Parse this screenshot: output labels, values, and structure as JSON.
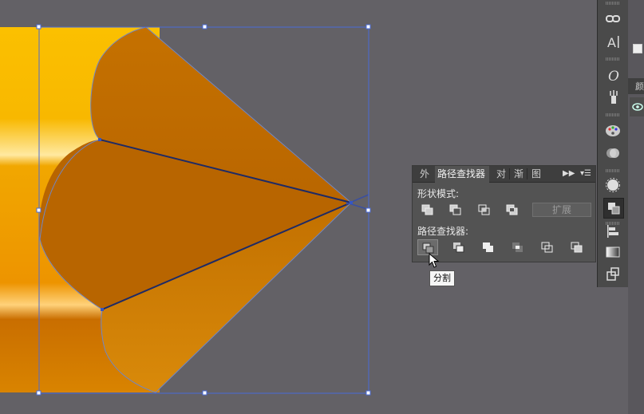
{
  "panel": {
    "tabs": [
      {
        "label": "外"
      },
      {
        "label": "路径查找器",
        "active": true
      },
      {
        "label": "对"
      },
      {
        "label": "渐"
      },
      {
        "label": "图"
      }
    ],
    "overflow_icon": "double-chevron-right-icon",
    "menu_icon": "panel-menu-icon",
    "shape_modes_label": "形状模式:",
    "pathfinders_label": "路径查找器:",
    "shape_mode_buttons": [
      "unite-icon",
      "minus-front-icon",
      "intersect-icon",
      "exclude-icon"
    ],
    "expand_label": "扩展",
    "pathfinder_buttons": [
      "divide-icon",
      "trim-icon",
      "merge-icon",
      "crop-icon",
      "outline-icon",
      "minus-back-icon"
    ]
  },
  "tooltip": "分割",
  "far_right": {
    "tab_label": "颜"
  },
  "colors": {
    "canvas": "#636166",
    "pencil_tip": "#c06f00",
    "pencil_body_yellow": "#f5b400",
    "selection": "#4a6bd8",
    "panel_bg": "#535353"
  },
  "toolbar_icons": [
    "link-icon",
    "character-icon",
    "opentype-icon",
    "brush-icon",
    "palette-icon",
    "color-guide-icon",
    "transparency-icon",
    "pathfinder-icon",
    "align-icon",
    "gradient-icon",
    "transform-icon"
  ]
}
